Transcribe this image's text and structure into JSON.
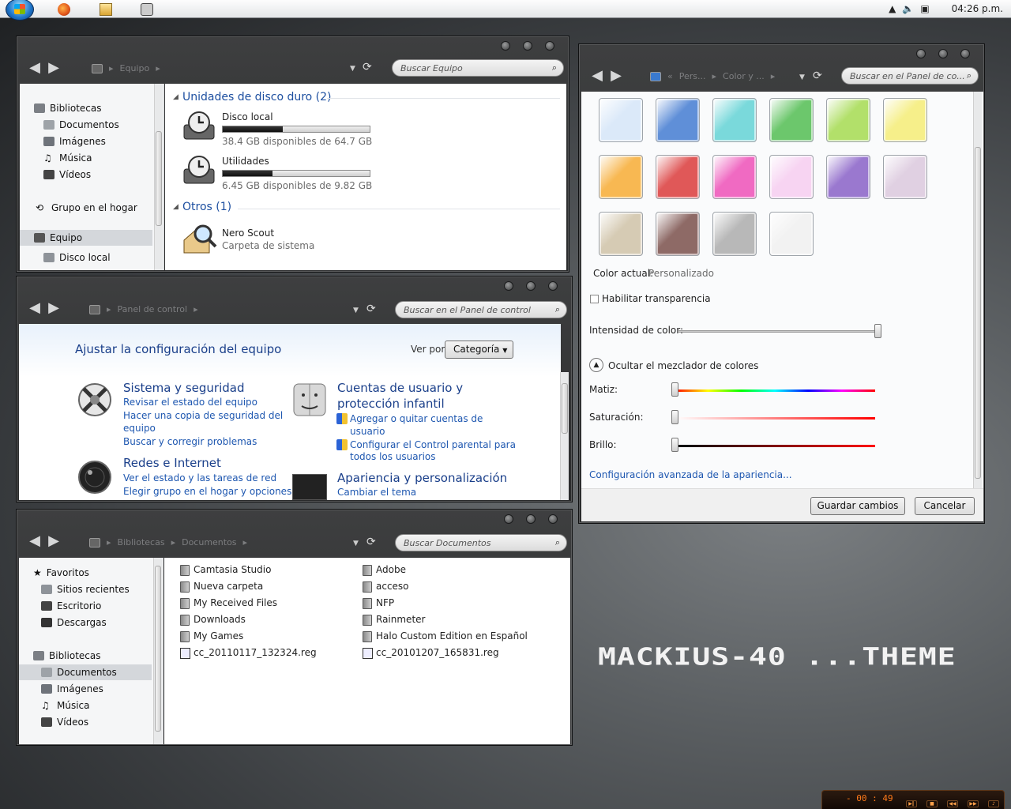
{
  "taskbar": {
    "clock": "04:26 p.m."
  },
  "win1": {
    "breadcrumb": [
      "Equipo"
    ],
    "search_placeholder": "Buscar Equipo",
    "nav": [
      "Bibliotecas",
      "Documentos",
      "Imágenes",
      "Música",
      "Vídeos",
      "Grupo en el hogar",
      "Equipo",
      "Disco local"
    ],
    "group1": "Unidades de disco duro (2)",
    "drives": [
      {
        "name": "Disco local",
        "info": "38.4 GB disponibles de 64.7 GB",
        "used_fraction": 0.41
      },
      {
        "name": "Utilidades",
        "info": "6.45 GB disponibles de 9.82 GB",
        "used_fraction": 0.34
      }
    ],
    "group2": "Otros (1)",
    "other": {
      "name": "Nero Scout",
      "sub": "Carpeta de sistema"
    }
  },
  "win2": {
    "breadcrumb": [
      "Panel de control"
    ],
    "search_placeholder": "Buscar en el Panel de control",
    "title": "Ajustar la configuración del equipo",
    "viewby_label": "Ver por:",
    "viewby_value": "Categoría",
    "categories": [
      {
        "title": "Sistema y seguridad",
        "links": [
          "Revisar el estado del equipo",
          "Hacer una copia de seguridad del",
          "equipo",
          "Buscar y corregir problemas"
        ]
      },
      {
        "title": "Redes e Internet",
        "links": [
          "Ver el estado y las tareas de red",
          "Elegir grupo en el hogar y opciones de"
        ]
      },
      {
        "title": "Cuentas de usuario y",
        "title2": "protección infantil",
        "links": [
          "Agregar o quitar cuentas de",
          "usuario",
          "Configurar el Control parental para",
          "todos los usuarios"
        ]
      },
      {
        "title": "Apariencia y personalización",
        "links": [
          "Cambiar el tema"
        ]
      }
    ]
  },
  "win3": {
    "breadcrumb": [
      "Bibliotecas",
      "Documentos"
    ],
    "search_placeholder": "Buscar Documentos",
    "nav": [
      "Favoritos",
      "Sitios recientes",
      "Escritorio",
      "Descargas",
      "Bibliotecas",
      "Documentos",
      "Imágenes",
      "Música",
      "Vídeos"
    ],
    "files_col1": [
      "Camtasia Studio",
      "Nueva carpeta",
      "My Received Files",
      "Downloads",
      "My Games",
      "cc_20110117_132324.reg"
    ],
    "files_col2": [
      "Adobe",
      "acceso",
      "NFP",
      "Rainmeter",
      "Halo Custom Edition en Español",
      "cc_20101207_165831.reg"
    ]
  },
  "win4": {
    "breadcrumb": [
      "Pers...",
      "Color y ..."
    ],
    "search_placeholder": "Buscar en el Panel de co...",
    "swatch_colors": [
      "#dbe9f9",
      "#5f8fd8",
      "#7ad9db",
      "#6cc76c",
      "#b2e06a",
      "#f6ef8a",
      "#f8b852",
      "#e05858",
      "#f06ac2",
      "#f7d4f2",
      "#9a78cf",
      "#e0d0e2",
      "#d6cbb4",
      "#8e6a66",
      "#b8b8b8",
      "#f2f2f2"
    ],
    "current_label": "Color actual:",
    "current_value": "Personalizado",
    "transparency": "Habilitar transparencia",
    "intensity": "Intensidad de color:",
    "mixer_toggle": "Ocultar el mezclador de colores",
    "hue": "Matiz:",
    "saturation": "Saturación:",
    "brightness": "Brillo:",
    "advanced": "Configuración avanzada de la apariencia...",
    "save": "Guardar cambios",
    "cancel": "Cancelar"
  },
  "desktop": {
    "theme_text": "MACKIUS-40 ...THEME"
  },
  "player": {
    "time": "- 00 : 49"
  }
}
